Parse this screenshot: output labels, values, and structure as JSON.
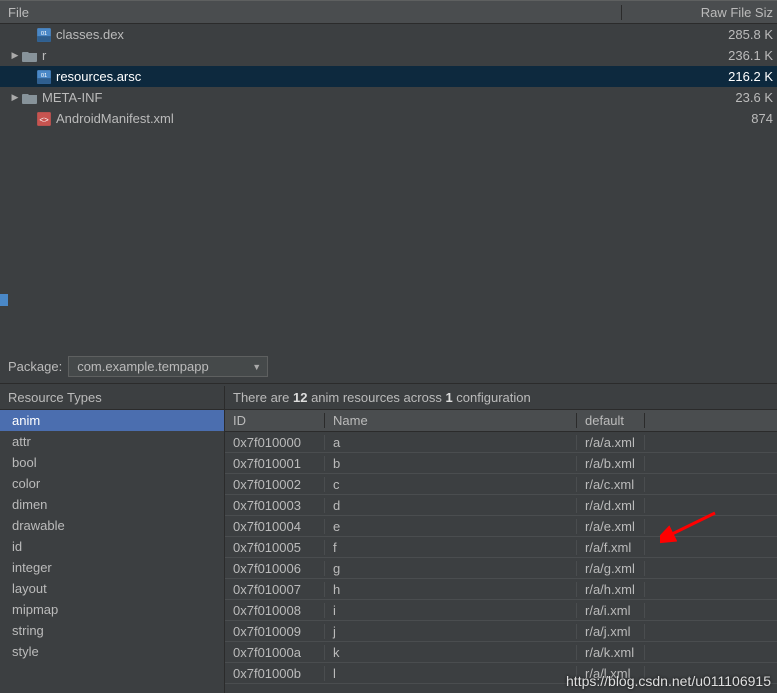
{
  "file_panel": {
    "header": {
      "file": "File",
      "size": "Raw File Siz"
    },
    "rows": [
      {
        "arrow": "",
        "indent": 14,
        "icon": "dex",
        "name": "classes.dex",
        "size": "285.8 K",
        "selected": false
      },
      {
        "arrow": "▶",
        "indent": 0,
        "icon": "folder",
        "name": "r",
        "size": "236.1 K",
        "selected": false
      },
      {
        "arrow": "",
        "indent": 14,
        "icon": "arsc",
        "name": "resources.arsc",
        "size": "216.2 K",
        "selected": true
      },
      {
        "arrow": "▶",
        "indent": 0,
        "icon": "folder",
        "name": "META-INF",
        "size": "23.6 K",
        "selected": false
      },
      {
        "arrow": "",
        "indent": 14,
        "icon": "xml",
        "name": "AndroidManifest.xml",
        "size": "874 ",
        "selected": false
      }
    ]
  },
  "package": {
    "label": "Package:",
    "value": "com.example.tempapp"
  },
  "resource_types": {
    "header": "Resource Types",
    "items": [
      "anim",
      "attr",
      "bool",
      "color",
      "dimen",
      "drawable",
      "id",
      "integer",
      "layout",
      "mipmap",
      "string",
      "style"
    ],
    "selected_index": 0
  },
  "detail": {
    "summary_pre": "There are ",
    "summary_count": "12",
    "summary_mid": " anim resources across ",
    "summary_cfg": "1",
    "summary_post": " configuration",
    "columns": {
      "id": "ID",
      "name": "Name",
      "default": "default"
    },
    "rows": [
      {
        "id": "0x7f010000",
        "name": "a",
        "default": "r/a/a.xml"
      },
      {
        "id": "0x7f010001",
        "name": "b",
        "default": "r/a/b.xml"
      },
      {
        "id": "0x7f010002",
        "name": "c",
        "default": "r/a/c.xml"
      },
      {
        "id": "0x7f010003",
        "name": "d",
        "default": "r/a/d.xml"
      },
      {
        "id": "0x7f010004",
        "name": "e",
        "default": "r/a/e.xml"
      },
      {
        "id": "0x7f010005",
        "name": "f",
        "default": "r/a/f.xml"
      },
      {
        "id": "0x7f010006",
        "name": "g",
        "default": "r/a/g.xml"
      },
      {
        "id": "0x7f010007",
        "name": "h",
        "default": "r/a/h.xml"
      },
      {
        "id": "0x7f010008",
        "name": "i",
        "default": "r/a/i.xml"
      },
      {
        "id": "0x7f010009",
        "name": "j",
        "default": "r/a/j.xml"
      },
      {
        "id": "0x7f01000a",
        "name": "k",
        "default": "r/a/k.xml"
      },
      {
        "id": "0x7f01000b",
        "name": "l",
        "default": "r/a/l.xml"
      }
    ]
  },
  "watermark": "https://blog.csdn.net/u011106915"
}
